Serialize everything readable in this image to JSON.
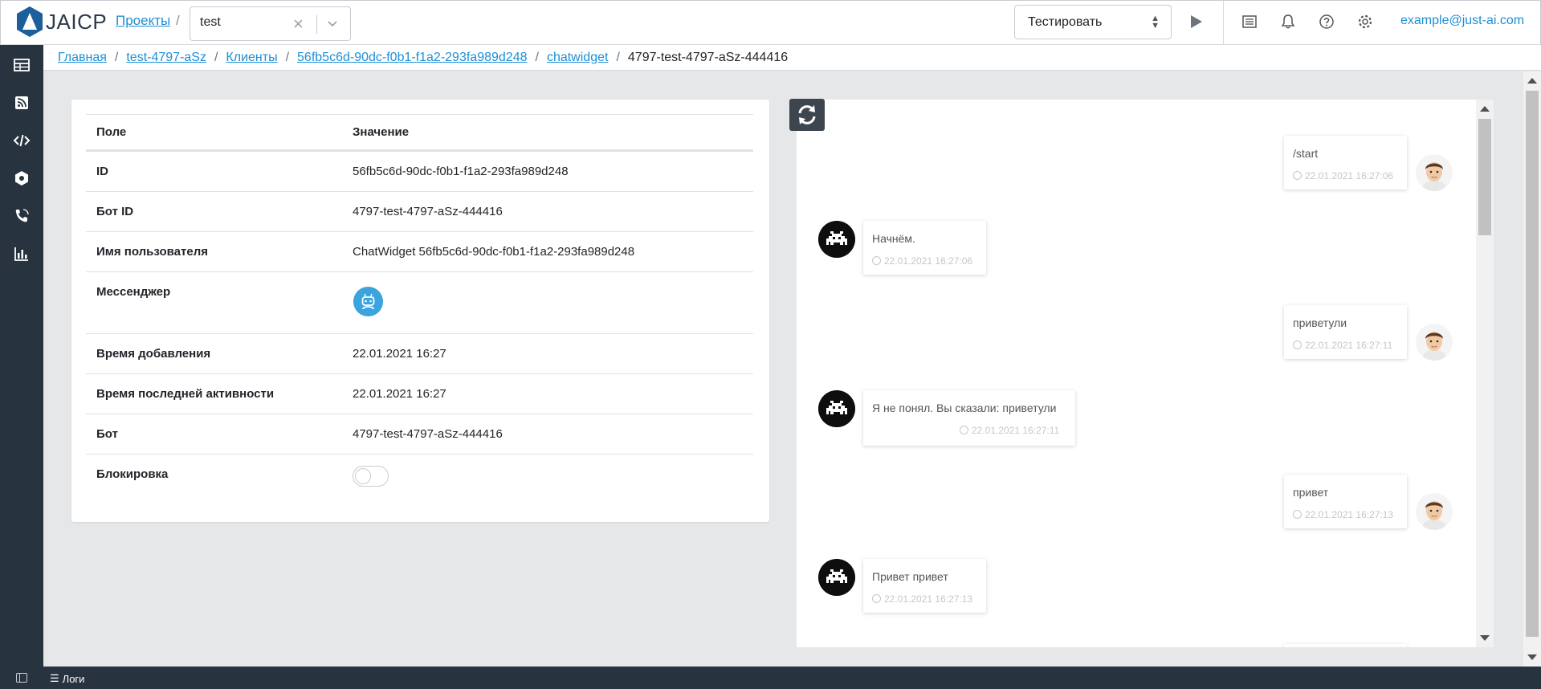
{
  "header": {
    "logo_text": "JAICP",
    "projects_link": "Проекты",
    "separator": "/",
    "project_select_value": "test",
    "test_select_value": "Тестировать",
    "user_email": "example@just-ai.com"
  },
  "breadcrumb": {
    "items": [
      "Главная",
      "test-4797-aSz",
      "Клиенты",
      "56fb5c6d-90dc-f0b1-f1a2-293fa989d248",
      "chatwidget"
    ],
    "current": "4797-test-4797-aSz-444416",
    "sep": "/"
  },
  "client_table": {
    "header": {
      "field": "Поле",
      "value": "Значение"
    },
    "rows": [
      {
        "field": "ID",
        "value": "56fb5c6d-90dc-f0b1-f1a2-293fa989d248"
      },
      {
        "field": "Бот ID",
        "value": "4797-test-4797-aSz-444416"
      },
      {
        "field": "Имя пользователя",
        "value": "ChatWidget 56fb5c6d-90dc-f0b1-f1a2-293fa989d248"
      },
      {
        "field": "Мессенджер",
        "value_icon": "robot-icon"
      },
      {
        "field": "Время добавления",
        "value": "22.01.2021 16:27"
      },
      {
        "field": "Время последней активности",
        "value": "22.01.2021 16:27"
      },
      {
        "field": "Бот",
        "value": "4797-test-4797-aSz-444416"
      },
      {
        "field": "Блокировка",
        "toggle_on": false
      }
    ]
  },
  "chat": {
    "messages": [
      {
        "from": "user",
        "text": "/start",
        "time": "22.01.2021 16:27:06"
      },
      {
        "from": "bot",
        "text": "Начнём.",
        "time": "22.01.2021 16:27:06"
      },
      {
        "from": "user",
        "text": "приветули",
        "time": "22.01.2021 16:27:11"
      },
      {
        "from": "bot",
        "text": "Я не понял. Вы сказали: приветули",
        "time": "22.01.2021 16:27:11"
      },
      {
        "from": "user",
        "text": "привет",
        "time": "22.01.2021 16:27:13"
      },
      {
        "from": "bot",
        "text": "Привет привет",
        "time": "22.01.2021 16:27:13"
      }
    ]
  },
  "footer": {
    "logs_label": "Логи"
  },
  "colors": {
    "accent": "#1e8fd6",
    "sidebar": "#27333e",
    "messenger_badge": "#3ba3de"
  }
}
